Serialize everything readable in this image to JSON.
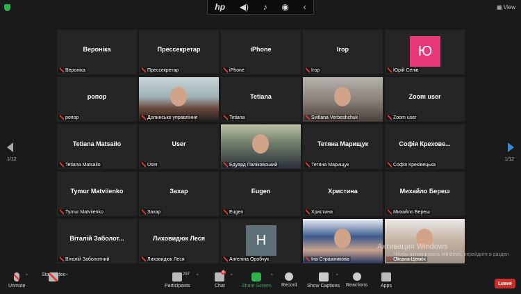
{
  "top": {
    "hp_logo": "hp",
    "view_label": "View"
  },
  "icons": {
    "hp_controls": [
      "volume-icon",
      "mic-icon",
      "broadcast-icon",
      "chevron-left-icon"
    ]
  },
  "pagination": {
    "left": "1/12",
    "right": "1/12"
  },
  "tiles": [
    {
      "big": "Вероніка",
      "label": "Вероніка"
    },
    {
      "big": "Прессекретар",
      "label": "Прессекретар"
    },
    {
      "big": "iPhone",
      "label": "iPhone"
    },
    {
      "big": "Ігор",
      "label": "Ігор"
    },
    {
      "avatar": "Ю",
      "label": "Юрій Сенів"
    },
    {
      "big": "ропор",
      "label": "ропор"
    },
    {
      "video": "v1",
      "label": "Долинське управління"
    },
    {
      "big": "Tetiana",
      "label": "Tetiana"
    },
    {
      "video": "v2",
      "label": "Svitlana Verbeshchuk"
    },
    {
      "big": "Zoom user",
      "label": "Zoom user"
    },
    {
      "big": "Tetiana Matsailo",
      "label": "Tetiana Matsailo"
    },
    {
      "big": "User",
      "label": "User"
    },
    {
      "video": "v3",
      "label": "Едуард Паліковський",
      "active": true
    },
    {
      "big": "Тетяна Марищук",
      "label": "Тетяна Марищук"
    },
    {
      "big": "Софія Крехове...",
      "label": "Софія Крехівецька"
    },
    {
      "big": "Tymur Matviienko",
      "label": "Tymur Matviienko"
    },
    {
      "big": "Захар",
      "label": "Захар"
    },
    {
      "big": "Eugen",
      "label": "Eugen"
    },
    {
      "big": "Христина",
      "label": "Христина"
    },
    {
      "big": "Михайло Береш",
      "label": "Михайло Береш"
    },
    {
      "big": "Віталій Заболот...",
      "label": "Віталій Заболотний"
    },
    {
      "big": "Лиховидюк Леся",
      "label": "Лиховидюк Леся"
    },
    {
      "avatar": "Н",
      "label": "Ангеліна Оробчук"
    },
    {
      "video": "v4",
      "label": "Іна Стражникова"
    },
    {
      "video": "v5",
      "label": "Оксана Цепюк"
    }
  ],
  "colors": {
    "avatar_ju": "#e8387a",
    "avatar_n": "#5f6f78",
    "active_border": "#d4df3a"
  },
  "watermark": {
    "line1": "Активация Windows",
    "line2": "Чтобы активировать Windows, перейдите в раздел \"Параметры\""
  },
  "toolbar": {
    "unmute": "Unmute",
    "start_video": "Start Video",
    "participants": "Participants",
    "participants_count": "297",
    "chat": "Chat",
    "chat_badge": "6",
    "share_screen": "Share Screen",
    "record": "Record",
    "show_captions": "Show Captions",
    "reactions": "Reactions",
    "apps": "Apps",
    "leave": "Leave"
  }
}
